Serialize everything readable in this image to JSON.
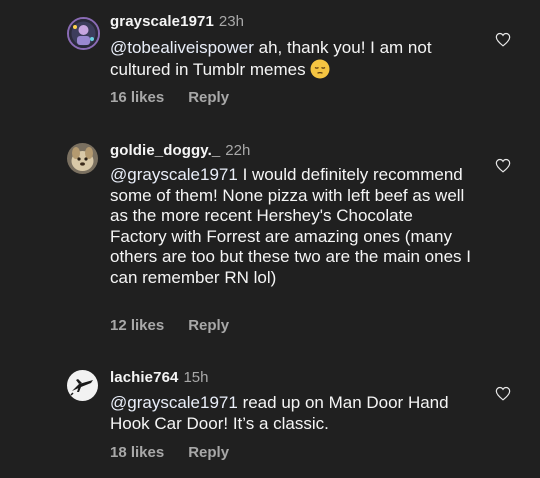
{
  "comments": [
    {
      "username": "grayscale1971",
      "time": "23h",
      "mention": "@tobealiveispower",
      "text": " ah, thank you!  I am not cultured in Tumblr memes ",
      "emoji": "pensive-face-emoji",
      "likes": "16 likes",
      "reply": "Reply"
    },
    {
      "username": "goldie_doggy._",
      "time": "22h",
      "mention": "@grayscale1971",
      "text": " I would definitely recommend some of them! None pizza with left beef as well as the more recent Hershey's Chocolate Factory with Forrest are amazing ones (many others are too but these two are the main ones I can remember RN lol)",
      "likes": "12 likes",
      "reply": "Reply"
    },
    {
      "username": "lachie764",
      "time": "15h",
      "mention": "@grayscale1971",
      "text": " read up on Man Door Hand Hook Car Door! It’s a classic.",
      "likes": "18 likes",
      "reply": "Reply"
    }
  ],
  "icons": {
    "like": "heart-outline-icon"
  },
  "colors": {
    "background": "#202020",
    "text": "#f5f5f5",
    "secondary": "#a8a8a8"
  }
}
